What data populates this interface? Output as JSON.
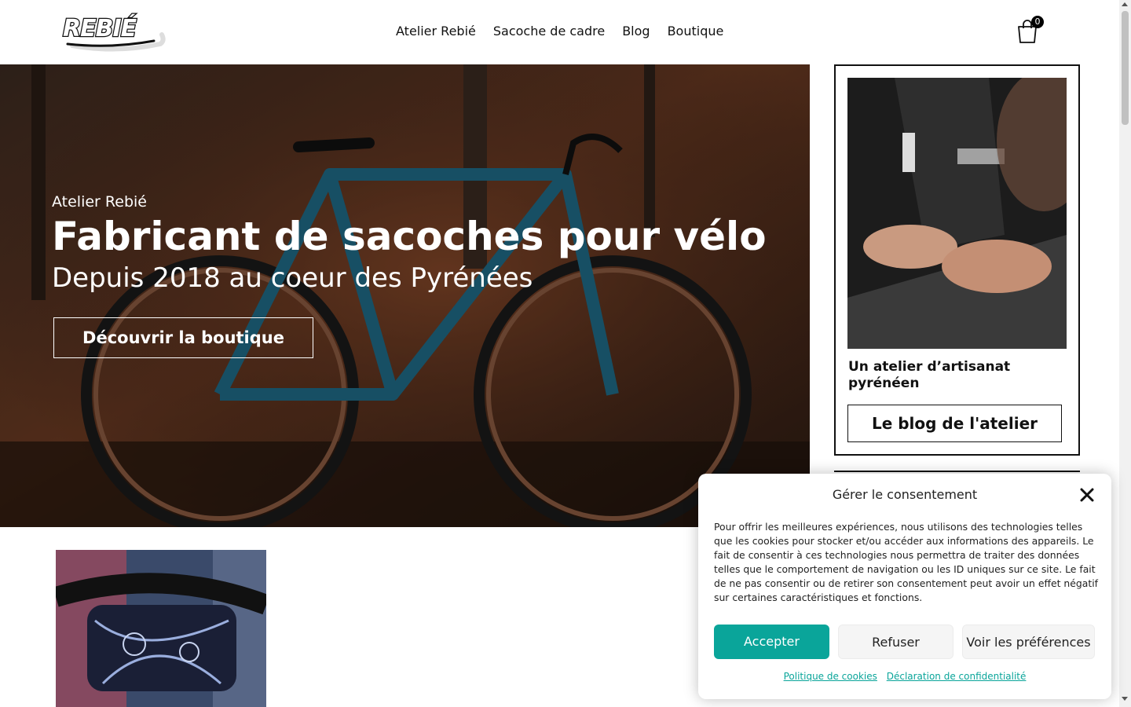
{
  "header": {
    "logo_text": "REBIÉ",
    "nav": [
      "Atelier Rebié",
      "Sacoche de cadre",
      "Blog",
      "Boutique"
    ],
    "cart_count": "0",
    "cart_icon": "shopping-bag-icon"
  },
  "hero": {
    "subtitle": "Atelier Rebié",
    "title": "Fabricant de sacoches pour vélo",
    "tagline": "Depuis 2018 au coeur des Pyrénées",
    "button": "Découvrir la boutique"
  },
  "card": {
    "title": "Un atelier d’artisanat pyrénéen",
    "button": "Le blog de l'atelier"
  },
  "consent": {
    "title": "Gérer le consentement",
    "text": "Pour offrir les meilleures expériences, nous utilisons des technologies telles que les cookies pour stocker et/ou accéder aux informations des appareils. Le fait de consentir à ces technologies nous permettra de traiter des données telles que le comportement de navigation ou les ID uniques sur ce site. Le fait de ne pas consentir ou de retirer son consentement peut avoir un effet négatif sur certaines caractéristiques et fonctions.",
    "accept": "Accepter",
    "refuse": "Refuser",
    "preferences": "Voir les préférences",
    "cookie_policy": "Politique de cookies",
    "privacy": "Déclaration de confidentialité"
  },
  "colors": {
    "accent": "#0aa59a",
    "text": "#111111"
  }
}
